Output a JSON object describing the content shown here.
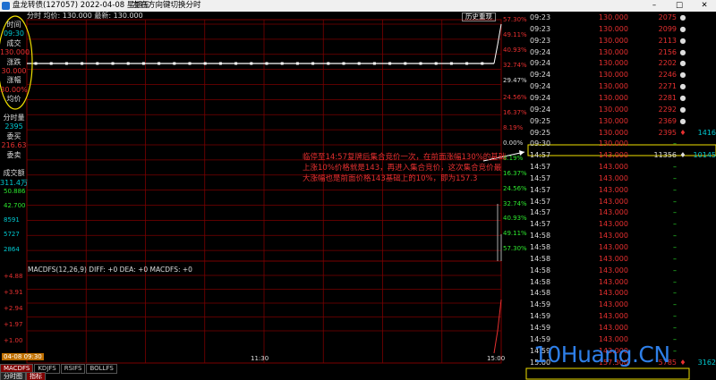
{
  "window": {
    "title": "盘龙转债(127057)  2022-04-08  星期五",
    "hint": "左右方向键切换分时",
    "buttons": [
      "–",
      "□",
      "✕"
    ]
  },
  "chart_header": {
    "label": "分时 均价: 130.000 最新: 130.000",
    "history_button": "历史重现"
  },
  "left_panel": {
    "items": [
      {
        "text": "时间",
        "color": "white"
      },
      {
        "text": "09:30",
        "color": "cyan"
      },
      {
        "text": "成交",
        "color": "white"
      },
      {
        "text": "130.000",
        "color": "red"
      },
      {
        "text": "涨跌",
        "color": "white"
      },
      {
        "text": "30.000",
        "color": "red"
      },
      {
        "text": "涨幅",
        "color": "white"
      },
      {
        "text": "30.00%",
        "color": "red"
      },
      {
        "text": "均价",
        "color": "white"
      },
      {
        "text": "",
        "color": "white"
      },
      {
        "text": "分时量",
        "color": "white"
      },
      {
        "text": "2395",
        "color": "cyan"
      },
      {
        "text": "委买",
        "color": "white"
      },
      {
        "text": "216.63",
        "color": "red"
      },
      {
        "text": "委卖",
        "color": "white"
      },
      {
        "text": "",
        "color": "white"
      },
      {
        "text": "成交额",
        "color": "white"
      },
      {
        "text": "311.4万",
        "color": "cyan"
      }
    ]
  },
  "right_axis_price_pct": [
    {
      "text": "57.30%",
      "color": "red"
    },
    {
      "text": "49.11%",
      "color": "red"
    },
    {
      "text": "40.93%",
      "color": "red"
    },
    {
      "text": "32.74%",
      "color": "red"
    },
    {
      "text": "29.47%",
      "color": "white"
    },
    {
      "text": "24.56%",
      "color": "red"
    },
    {
      "text": "16.37%",
      "color": "red"
    },
    {
      "text": "8.19%",
      "color": "red"
    },
    {
      "text": "0.00%",
      "color": "white"
    },
    {
      "text": "8.19%",
      "color": "green"
    },
    {
      "text": "16.37%",
      "color": "green"
    },
    {
      "text": "24.56%",
      "color": "green"
    },
    {
      "text": "32.74%",
      "color": "green"
    },
    {
      "text": "40.93%",
      "color": "green"
    },
    {
      "text": "49.11%",
      "color": "green"
    },
    {
      "text": "57.30%",
      "color": "green"
    }
  ],
  "volume_axis": [
    "50.886",
    "42.700",
    "8591",
    "5727",
    "2864"
  ],
  "macd": {
    "header": "MACDFS(12,26,9) DIFF: +0 DEA: +0 MACDFS: +0",
    "ticks": [
      "+4.88",
      "+3.91",
      "+2.94",
      "+1.97",
      "+1.00"
    ]
  },
  "time_axis": [
    "09:30",
    "11:30",
    "15:00"
  ],
  "time_axis_box": "04-08 09:30",
  "indicator_tabs": [
    "MACDFS",
    "KDJFS",
    "RSIFS",
    "BOLLFS"
  ],
  "bottom_tabs": [
    "分时图",
    "指标"
  ],
  "ticks": [
    {
      "time": "09:23",
      "price": "130.000",
      "vol": "2075",
      "arrow": "●",
      "arrow_color": "white",
      "extra": ""
    },
    {
      "time": "09:23",
      "price": "130.000",
      "vol": "2099",
      "arrow": "●",
      "arrow_color": "white",
      "extra": ""
    },
    {
      "time": "09:23",
      "price": "130.000",
      "vol": "2113",
      "arrow": "●",
      "arrow_color": "white",
      "extra": ""
    },
    {
      "time": "09:24",
      "price": "130.000",
      "vol": "2156",
      "arrow": "●",
      "arrow_color": "white",
      "extra": ""
    },
    {
      "time": "09:24",
      "price": "130.000",
      "vol": "2202",
      "arrow": "●",
      "arrow_color": "white",
      "extra": ""
    },
    {
      "time": "09:24",
      "price": "130.000",
      "vol": "2246",
      "arrow": "●",
      "arrow_color": "white",
      "extra": ""
    },
    {
      "time": "09:24",
      "price": "130.000",
      "vol": "2271",
      "arrow": "●",
      "arrow_color": "white",
      "extra": ""
    },
    {
      "time": "09:24",
      "price": "130.000",
      "vol": "2281",
      "arrow": "●",
      "arrow_color": "white",
      "extra": ""
    },
    {
      "time": "09:24",
      "price": "130.000",
      "vol": "2292",
      "arrow": "●",
      "arrow_color": "white",
      "extra": ""
    },
    {
      "time": "09:25",
      "price": "130.000",
      "vol": "2369",
      "arrow": "●",
      "arrow_color": "white",
      "extra": ""
    },
    {
      "time": "09:25",
      "price": "130.000",
      "vol": "2395",
      "arrow": "♦",
      "arrow_color": "red",
      "extra": "1416"
    },
    {
      "time": "09:30",
      "price": "130.000",
      "vol": "–",
      "arrow": "",
      "arrow_color": "white",
      "extra": ""
    },
    {
      "time": "14:57",
      "price": "143.000",
      "vol": "11356",
      "arrow": "♦",
      "arrow_color": "white",
      "extra": "10145",
      "highlight": true
    },
    {
      "time": "14:57",
      "price": "143.000",
      "vol": "–",
      "arrow": "",
      "arrow_color": "white",
      "extra": ""
    },
    {
      "time": "14:57",
      "price": "143.000",
      "vol": "–",
      "arrow": "",
      "arrow_color": "white",
      "extra": ""
    },
    {
      "time": "14:57",
      "price": "143.000",
      "vol": "–",
      "arrow": "",
      "arrow_color": "white",
      "extra": ""
    },
    {
      "time": "14:57",
      "price": "143.000",
      "vol": "–",
      "arrow": "",
      "arrow_color": "white",
      "extra": ""
    },
    {
      "time": "14:57",
      "price": "143.000",
      "vol": "–",
      "arrow": "",
      "arrow_color": "white",
      "extra": ""
    },
    {
      "time": "14:57",
      "price": "143.000",
      "vol": "–",
      "arrow": "",
      "arrow_color": "white",
      "extra": ""
    },
    {
      "time": "14:58",
      "price": "143.000",
      "vol": "–",
      "arrow": "",
      "arrow_color": "white",
      "extra": ""
    },
    {
      "time": "14:58",
      "price": "143.000",
      "vol": "–",
      "arrow": "",
      "arrow_color": "white",
      "extra": ""
    },
    {
      "time": "14:58",
      "price": "143.000",
      "vol": "–",
      "arrow": "",
      "arrow_color": "white",
      "extra": ""
    },
    {
      "time": "14:58",
      "price": "143.000",
      "vol": "–",
      "arrow": "",
      "arrow_color": "white",
      "extra": ""
    },
    {
      "time": "14:58",
      "price": "143.000",
      "vol": "–",
      "arrow": "",
      "arrow_color": "white",
      "extra": ""
    },
    {
      "time": "14:58",
      "price": "143.000",
      "vol": "–",
      "arrow": "",
      "arrow_color": "white",
      "extra": ""
    },
    {
      "time": "14:59",
      "price": "143.000",
      "vol": "–",
      "arrow": "",
      "arrow_color": "white",
      "extra": ""
    },
    {
      "time": "14:59",
      "price": "143.000",
      "vol": "–",
      "arrow": "",
      "arrow_color": "white",
      "extra": ""
    },
    {
      "time": "14:59",
      "price": "143.000",
      "vol": "–",
      "arrow": "",
      "arrow_color": "white",
      "extra": ""
    },
    {
      "time": "14:59",
      "price": "143.000",
      "vol": "–",
      "arrow": "",
      "arrow_color": "white",
      "extra": ""
    },
    {
      "time": "14:59",
      "price": "143.000",
      "vol": "–",
      "arrow": "",
      "arrow_color": "white",
      "extra": ""
    },
    {
      "time": "15:00",
      "price": "157.300",
      "vol": "5785",
      "arrow": "♦",
      "arrow_color": "red",
      "extra": "3162",
      "highlight": true
    }
  ],
  "callout": "临停至14:57复牌后集合竞价一次，在前面涨幅130%的基础上涨10%价格就是143，再进入集合竞价，这次集合竞价最大涨幅也是前面价格143基础上的10%，即为157.3",
  "watermark": "10Huang.CN",
  "colors": {
    "up": "#e83030",
    "down": "#2ee82e",
    "grid": "#7a0000",
    "highlight": "#f0e000",
    "price_line": "#ffffff"
  }
}
